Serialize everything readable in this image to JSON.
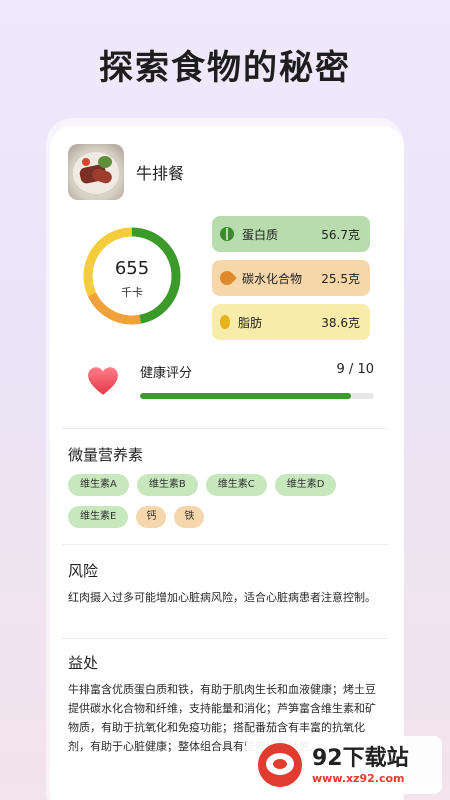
{
  "headline": "探索食物的秘密",
  "food": {
    "name": "牛排餐"
  },
  "calories": {
    "value": "655",
    "unit": "千卡"
  },
  "macros": [
    {
      "label": "蛋白质",
      "value": "56.7克",
      "color": "#b9dcae",
      "icon": "bean-icon"
    },
    {
      "label": "碳水化合物",
      "value": "25.5克",
      "color": "#f5d7aa",
      "icon": "grain-icon"
    },
    {
      "label": "脂肪",
      "value": "38.6克",
      "color": "#f8ecab",
      "icon": "oil-drop-icon"
    }
  ],
  "ring_colors": {
    "protein": "#3c9a2b",
    "carb": "#f0a13a",
    "fat": "#f5cd3a"
  },
  "health": {
    "label": "健康评分",
    "score_text": "9 / 10",
    "score": 9,
    "max": 10,
    "color": "#3c9a2b"
  },
  "micronutrients": {
    "title": "微量营养素",
    "vitamins": [
      "维生素A",
      "维生素B",
      "维生素C",
      "维生素D",
      "维生素E"
    ],
    "minerals": [
      "钙",
      "铁"
    ]
  },
  "risk": {
    "title": "风险",
    "text": "红肉摄入过多可能增加心脏病风险，适合心脏病患者注意控制。"
  },
  "benefit": {
    "title": "益处",
    "text": "牛排富含优质蛋白质和铁，有助于肌肉生长和血液健康；烤土豆提供碳水化合物和纤维，支持能量和消化；芦笋富含维生素和矿物质，有助于抗氧化和免疫功能；搭配番茄含有丰富的抗氧化剂，有助于心脏健康；整体组合具有营养均衡特性。"
  },
  "watermark": {
    "title": "92下载站",
    "url": "www.xz92.com"
  }
}
